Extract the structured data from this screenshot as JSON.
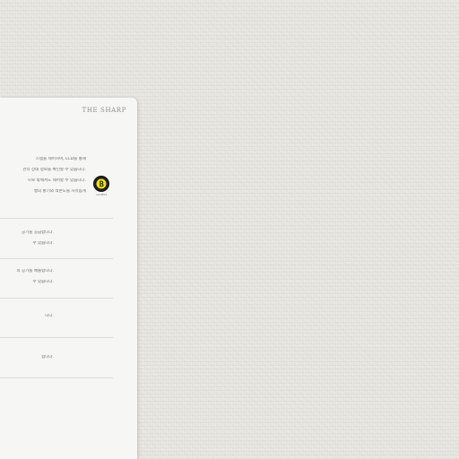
{
  "panel": {
    "brand": "THE SHARP",
    "intro_lines": [
      "스템을 제어하며, LCD를 통해",
      "관리 상태 정보를 확인할 수 있습니다.",
      "으로 밖에서도 제어할 수 있습니다.",
      "뱅의 밝기와 색온도를 자유롭게"
    ],
    "sections": [
      [
        "공기를 공급합니다.",
        "수 있습니다."
      ],
      [
        "의 공기를 배출합니다.",
        "수 있습니다."
      ],
      [
        "니다."
      ],
      [
        "합니다."
      ]
    ],
    "badge": {
      "icon": "b-logo-icon",
      "label": "certified",
      "color": "#f2e600"
    }
  }
}
